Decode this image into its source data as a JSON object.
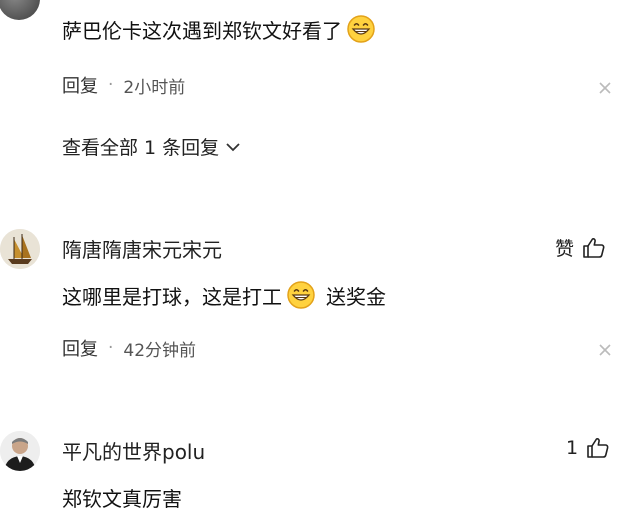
{
  "comments": [
    {
      "text": "萨巴伦卡这次遇到郑钦文好看了",
      "emoji": "grinning-face-icon",
      "reply_label": "回复",
      "time": "2小时前",
      "view_all": "查看全部 1 条回复"
    },
    {
      "user": "隋唐隋唐宋元宋元",
      "like_label": "赞",
      "text_before": "这哪里是打球，这是打工",
      "emoji": "grinning-face-icon",
      "text_after": "送奖金",
      "reply_label": "回复",
      "time": "42分钟前"
    },
    {
      "user": "平凡的世界polu",
      "like_count": "1",
      "text": "郑钦文真厉害"
    }
  ],
  "colors": {
    "text": "#111111",
    "meta": "#555555",
    "close": "#bbbbbb"
  }
}
